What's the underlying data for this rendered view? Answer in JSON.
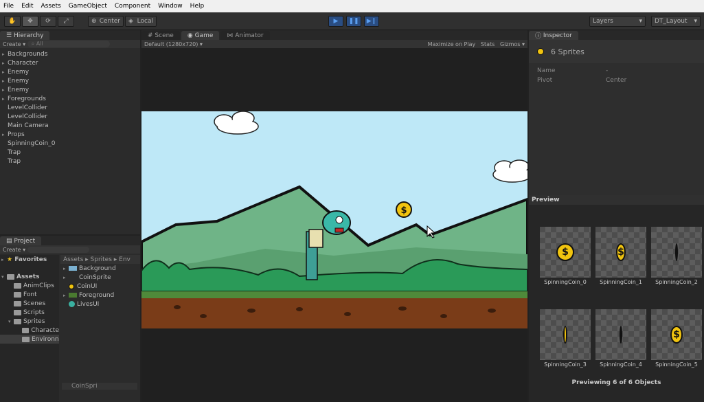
{
  "menu": [
    "File",
    "Edit",
    "Assets",
    "GameObject",
    "Component",
    "Window",
    "Help"
  ],
  "toolbar": {
    "pivot": "Center",
    "space": "Local",
    "layers": "Layers",
    "layout": "DT_Layout"
  },
  "hierarchy": {
    "tab": "Hierarchy",
    "create": "Create",
    "search": "All",
    "items": [
      {
        "label": "Backgrounds",
        "expand": true
      },
      {
        "label": "Character",
        "expand": true
      },
      {
        "label": "Enemy",
        "expand": true
      },
      {
        "label": "Enemy",
        "expand": true
      },
      {
        "label": "Enemy",
        "expand": true
      },
      {
        "label": "Foregrounds",
        "expand": true
      },
      {
        "label": "LevelCollider",
        "expand": false
      },
      {
        "label": "LevelCollider",
        "expand": false
      },
      {
        "label": "Main Camera",
        "expand": false
      },
      {
        "label": "Props",
        "expand": true
      },
      {
        "label": "SpinningCoin_0",
        "expand": false
      },
      {
        "label": "Trap",
        "expand": false
      },
      {
        "label": "Trap",
        "expand": false
      }
    ]
  },
  "views": {
    "tabs": [
      "Scene",
      "Game",
      "Animator"
    ],
    "resolution": "Default (1280x720)",
    "maximize": "Maximize on Play",
    "stats": "Stats",
    "gizmos": "Gizmos"
  },
  "project": {
    "tab": "Project",
    "create": "Create",
    "favorites": "Favorites",
    "tree": [
      "Assets",
      "AnimClips",
      "Font",
      "Scenes",
      "Scripts",
      "Sprites",
      "Characte",
      "Environn"
    ],
    "breadcrumb": "Assets ▸ Sprites ▸ Env",
    "files": [
      "Background",
      "CoinSprite",
      "CoinUI",
      "Foreground",
      "LivesUI"
    ],
    "footer": "CoinSpri"
  },
  "inspector": {
    "tab": "Inspector",
    "title": "6 Sprites",
    "name_label": "Name",
    "name_value": "-",
    "pivot_label": "Pivot",
    "pivot_value": "Center"
  },
  "preview": {
    "title": "Preview",
    "sprites": [
      "SpinningCoin_0",
      "SpinningCoin_1",
      "SpinningCoin_2",
      "SpinningCoin_3",
      "SpinningCoin_4",
      "SpinningCoin_5"
    ],
    "coin_widths": [
      1,
      0.55,
      0.12,
      0.22,
      0.1,
      0.7
    ],
    "footer": "Previewing 6 of 6 Objects"
  },
  "colors": {
    "sky": "#bee8f7",
    "hill": "#6fb487",
    "grass": "#2a9a58",
    "dirt": "#7a3c18",
    "coin": "#f1c40f"
  }
}
